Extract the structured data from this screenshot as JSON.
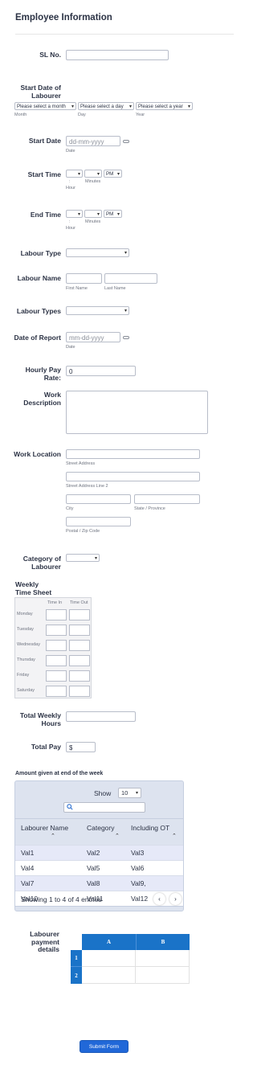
{
  "form_title": "Employee Information",
  "sl_no": {
    "label": "SL No.",
    "value": ""
  },
  "start_date_labourer": {
    "label": "Start Date of Labourer",
    "month_placeholder": "Please select a month",
    "day_placeholder": "Please select a day",
    "year_placeholder": "Please select a year",
    "month_sub": "Month",
    "day_sub": "Day",
    "year_sub": "Year"
  },
  "start_date": {
    "label": "Start Date",
    "placeholder": "dd-mm-yyyy",
    "sub": "Date"
  },
  "start_time": {
    "label": "Start Time",
    "ampm": "PM",
    "sep": ":",
    "hour_sub": "Hour",
    "minutes_sub": "Minutes"
  },
  "end_time": {
    "label": "End Time",
    "ampm": "PM",
    "sep": ":",
    "hour_sub": "Hour",
    "minutes_sub": "Minutes"
  },
  "labour_type": {
    "label": "Labour Type"
  },
  "labour_name": {
    "label": "Labour Name",
    "first_sub": "First Name",
    "last_sub": "Last Name"
  },
  "labour_types": {
    "label": "Labour Types"
  },
  "date_of_report": {
    "label": "Date of Report",
    "placeholder": "mm-dd-yyyy",
    "sub": "Date"
  },
  "hourly_pay": {
    "label": "Hourly Pay Rate:",
    "value": "0"
  },
  "work_description": {
    "label": "Work Description"
  },
  "work_location": {
    "label": "Work Location",
    "street_sub": "Street Address",
    "street2_sub": "Street Address Line 2",
    "city_sub": "City",
    "state_sub": "State / Province",
    "postal_sub": "Postal / Zip Code"
  },
  "category_of_labourer": {
    "label": "Category of Labourer"
  },
  "weekly_time_sheet": {
    "label": "Weekly Time Sheet",
    "col_in": "Time In",
    "col_out": "Time Out",
    "days": [
      "Monday",
      "Tuesday",
      "Wednesday",
      "Thursday",
      "Friday",
      "Saturday"
    ]
  },
  "total_weekly_hours": {
    "label": "Total Weekly Hours"
  },
  "total_pay": {
    "label": "Total Pay",
    "prefix": "$"
  },
  "amount_table": {
    "heading": "Amount given at end of the week",
    "show_label": "Show",
    "show_value": "10",
    "columns": [
      "Labourer Name",
      "Category",
      "Including OT"
    ],
    "rows": [
      [
        "Val1",
        "Val2",
        "Val3"
      ],
      [
        "Val4",
        "Val5",
        "Val6"
      ],
      [
        "Val7",
        "Val8",
        "Val9,"
      ],
      [
        "Val10",
        "Val11",
        "Val12"
      ]
    ],
    "footer": "Showing 1 to 4 of 4 entries"
  },
  "payment_details": {
    "label": "Labourer payment details",
    "columns": [
      "A",
      "B"
    ],
    "rows": [
      "1",
      "2"
    ]
  },
  "submit_label": "Submit Form",
  "colors": {
    "accent": "#2168d8",
    "grid_header": "#1a73c8",
    "table_bg": "#dde3ef",
    "row_highlight": "#e6e9f8"
  }
}
